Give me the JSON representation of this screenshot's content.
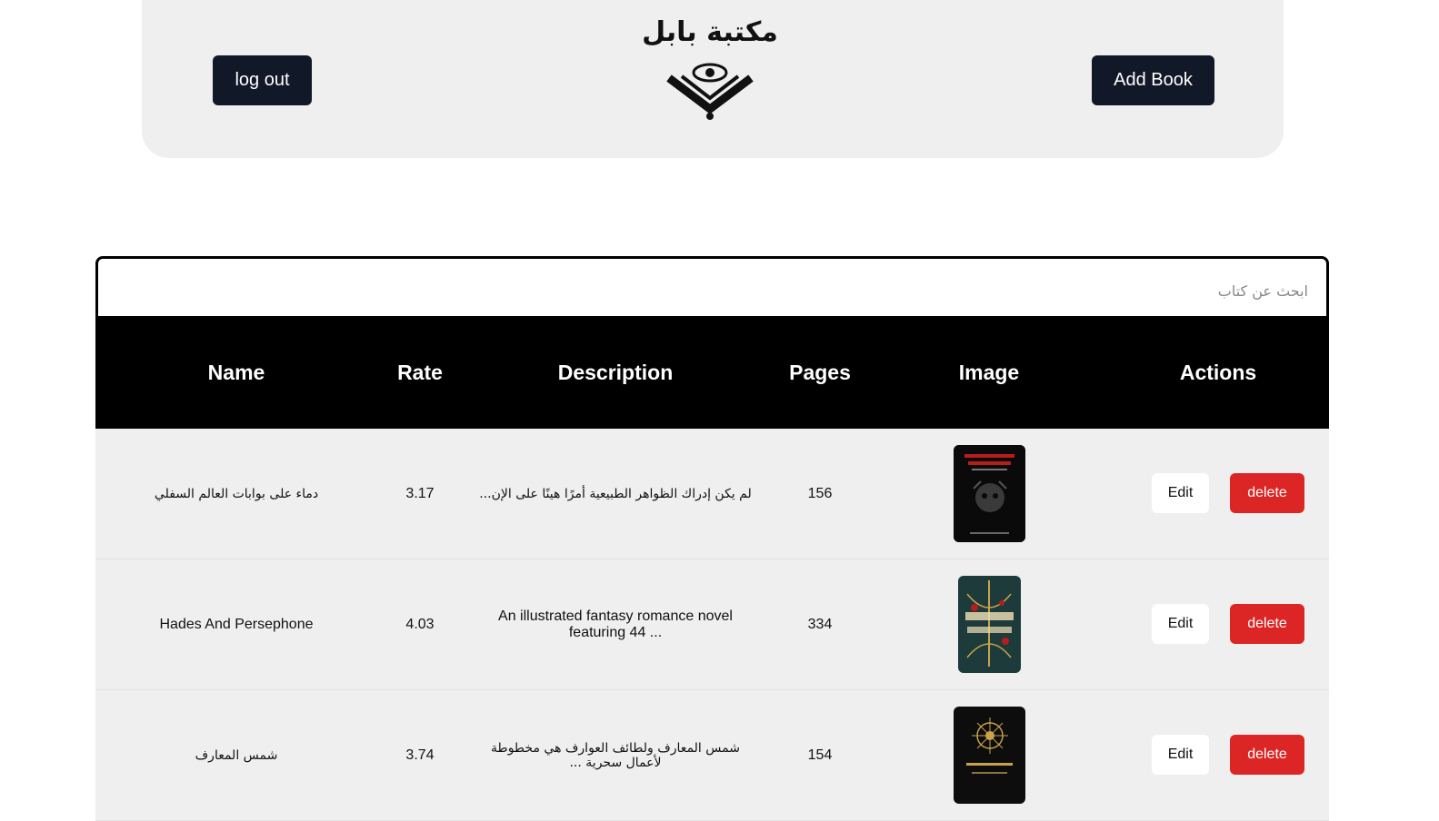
{
  "header": {
    "logout_label": "log out",
    "add_book_label": "Add Book",
    "logo_text": "مكتبة بابل"
  },
  "search": {
    "placeholder": "ابحث عن كتاب"
  },
  "table": {
    "columns": [
      "Name",
      "Rate",
      "Description",
      "Pages",
      "Image",
      "Actions"
    ],
    "rows": [
      {
        "name": "دماء على بوابات العالم السفلي",
        "rate": "3.17",
        "description": "لم يكن إدراك الظواهر الطبيعية أمرًا هينًا على الإن...",
        "pages": "156",
        "edit_label": "Edit",
        "delete_label": "delete"
      },
      {
        "name": "Hades And Persephone",
        "rate": "4.03",
        "description": "An illustrated fantasy romance novel featuring 44 ...",
        "pages": "334",
        "edit_label": "Edit",
        "delete_label": "delete"
      },
      {
        "name": "شمس المعارف",
        "rate": "3.74",
        "description": "شمس المعارف ولطائف العوارف هي مخطوطة لأعمال سحرية ...",
        "pages": "154",
        "edit_label": "Edit",
        "delete_label": "delete"
      }
    ]
  },
  "colors": {
    "dark_button": "#111827",
    "delete_button": "#dc2626",
    "header_bg": "#efefef",
    "table_head_bg": "#000000"
  }
}
